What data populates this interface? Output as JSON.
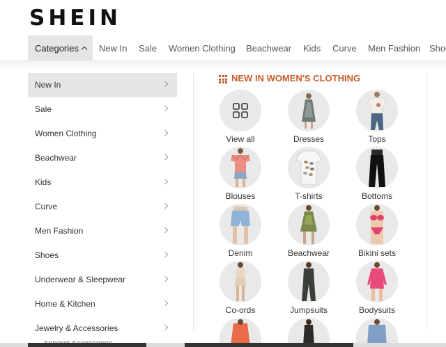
{
  "brand": {
    "logo_text": "SHEIN"
  },
  "nav": {
    "items": [
      {
        "label": "Categories"
      },
      {
        "label": "New In"
      },
      {
        "label": "Sale"
      },
      {
        "label": "Women Clothing"
      },
      {
        "label": "Beachwear"
      },
      {
        "label": "Kids"
      },
      {
        "label": "Curve"
      },
      {
        "label": "Men Fashion"
      },
      {
        "label": "Shoe"
      }
    ]
  },
  "menu": {
    "items": [
      {
        "label": "New In"
      },
      {
        "label": "Sale"
      },
      {
        "label": "Women Clothing"
      },
      {
        "label": "Beachwear"
      },
      {
        "label": "Kids"
      },
      {
        "label": "Curve"
      },
      {
        "label": "Men Fashion"
      },
      {
        "label": "Shoes"
      },
      {
        "label": "Underwear & Sleepwear"
      },
      {
        "label": "Home & Kitchen"
      },
      {
        "label": "Jewelry & Accessories"
      }
    ],
    "partial_item": "Apparel Accessories"
  },
  "section": {
    "title": "NEW IN WOMEN'S CLOTHING",
    "accent_color": "#c75b2a",
    "tiles": [
      {
        "label": "View all",
        "icon": "view-all-grid-icon"
      },
      {
        "label": "Dresses",
        "icon": "dress-image"
      },
      {
        "label": "Tops",
        "icon": "top-image"
      },
      {
        "label": "Blouses",
        "icon": "blouse-image"
      },
      {
        "label": "T-shirts",
        "icon": "tshirt-image"
      },
      {
        "label": "Bottoms",
        "icon": "bottoms-image"
      },
      {
        "label": "Denim",
        "icon": "denim-image"
      },
      {
        "label": "Beachwear",
        "icon": "beachwear-image"
      },
      {
        "label": "Bikini sets",
        "icon": "bikini-image"
      },
      {
        "label": "Co-ords",
        "icon": "coords-image"
      },
      {
        "label": "Jumpsuits",
        "icon": "jumpsuit-image"
      },
      {
        "label": "Bodysuits",
        "icon": "bodysuit-image"
      }
    ]
  }
}
